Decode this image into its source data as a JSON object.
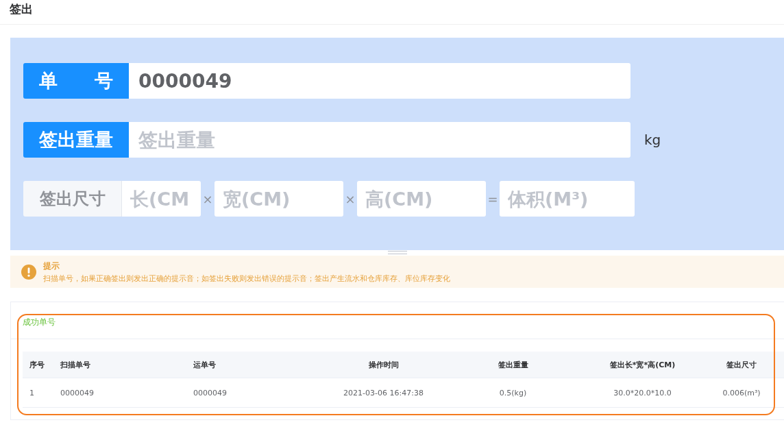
{
  "page_title": "签出",
  "form": {
    "order": {
      "label": "单　　号",
      "value": "0000049"
    },
    "weight": {
      "label": "签出重量",
      "placeholder": "签出重量",
      "unit": "kg"
    },
    "size": {
      "label": "签出尺寸",
      "fields": [
        {
          "placeholder": "长(CM",
          "operator": "×"
        },
        {
          "placeholder": "宽(CM)",
          "operator": "×"
        },
        {
          "placeholder": "高(CM)",
          "operator": "="
        },
        {
          "placeholder": "体积(M³)"
        }
      ]
    }
  },
  "alert": {
    "title": "提示",
    "text": "扫描单号，如果正确签出则发出正确的提示音；如签出失败则发出错误的提示音；签出产生流水和仓库库存、库位库存变化"
  },
  "result": {
    "title": "成功单号",
    "table": {
      "columns": [
        "序号",
        "扫描单号",
        "运单号",
        "操作时间",
        "签出重量",
        "签出长*宽*高(CM)",
        "签出尺寸"
      ],
      "rows": [
        [
          "1",
          "0000049",
          "0000049",
          "2021-03-06 16:47:38",
          "0.5(kg)",
          "30.0*20.0*10.0",
          "0.006(m³)"
        ]
      ]
    }
  }
}
